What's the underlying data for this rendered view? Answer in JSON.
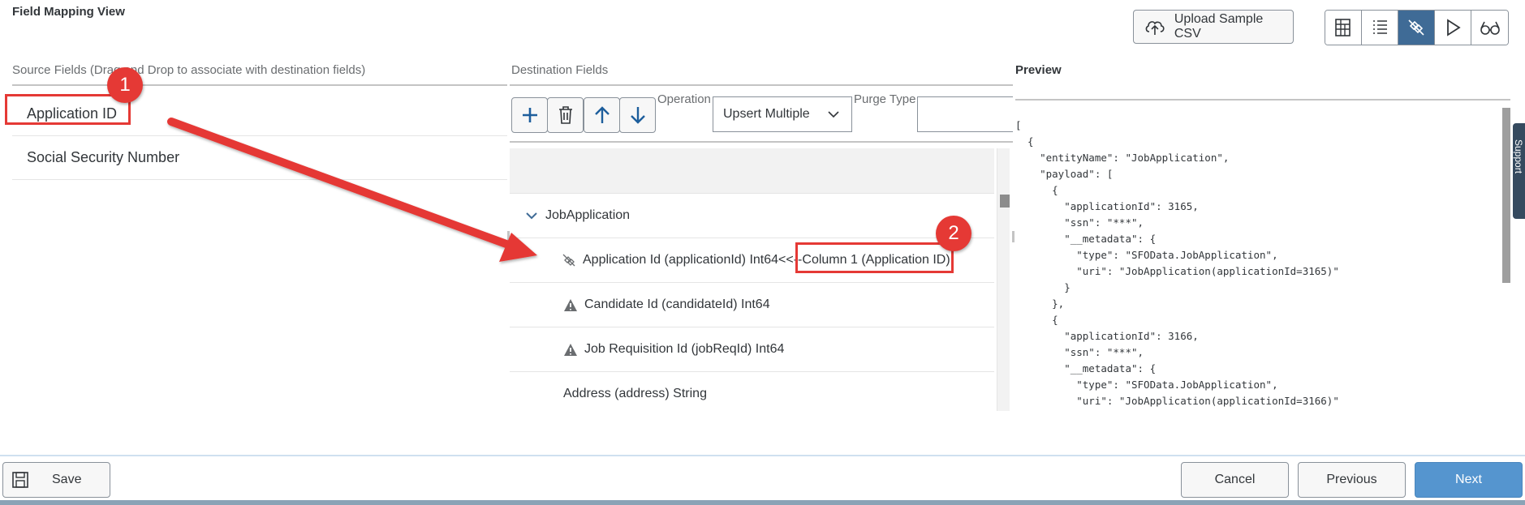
{
  "header": {
    "title": "Field Mapping View",
    "upload_label": "Upload Sample CSV"
  },
  "view_switch": {
    "items": [
      {
        "icon": "table-grid-icon",
        "active": false
      },
      {
        "icon": "list-icon",
        "active": false
      },
      {
        "icon": "mapping-link-icon",
        "active": true
      },
      {
        "icon": "play-icon",
        "active": false
      },
      {
        "icon": "glasses-icon",
        "active": false
      }
    ]
  },
  "source": {
    "title": "Source Fields (Drag and Drop to associate with destination fields)",
    "items": [
      "Application ID",
      "Social Security Number"
    ]
  },
  "destination": {
    "title": "Destination Fields",
    "toolbar": [
      "plus-icon",
      "delete-icon",
      "arrow-up-icon",
      "arrow-down-icon"
    ],
    "operation_label": "Operation",
    "operation_value": "Upsert Multiple",
    "purge_label": "Purge Type",
    "group_label": "JobApplication",
    "rows": [
      {
        "icon": "link-icon",
        "label": "Application Id (applicationId) Int64<<--",
        "mapped": "Column 1 (Application ID)"
      },
      {
        "icon": "warning-icon",
        "label": "Candidate Id (candidateId) Int64"
      },
      {
        "icon": "warning-icon",
        "label": "Job Requisition Id (jobReqId) Int64"
      },
      {
        "icon": "",
        "label": "Address (address) String"
      }
    ]
  },
  "preview": {
    "title": "Preview",
    "lines": [
      "[",
      "  {",
      "    \"entityName\": \"JobApplication\",",
      "    \"payload\": [",
      "      {",
      "        \"applicationId\": 3165,",
      "        \"ssn\": \"***\",",
      "        \"__metadata\": {",
      "          \"type\": \"SFOData.JobApplication\",",
      "          \"uri\": \"JobApplication(applicationId=3165)\"",
      "        }",
      "      },",
      "      {",
      "        \"applicationId\": 3166,",
      "        \"ssn\": \"***\",",
      "        \"__metadata\": {",
      "          \"type\": \"SFOData.JobApplication\",",
      "          \"uri\": \"JobApplication(applicationId=3166)\""
    ]
  },
  "support_label": "Support",
  "footer": {
    "save": "Save",
    "cancel": "Cancel",
    "previous": "Previous",
    "next": "Next"
  },
  "annotations": {
    "badge1": "1",
    "badge2": "2"
  },
  "colors": {
    "accent": "#3f6b96",
    "primary_button": "#5595cf",
    "annotation": "#e53935"
  }
}
